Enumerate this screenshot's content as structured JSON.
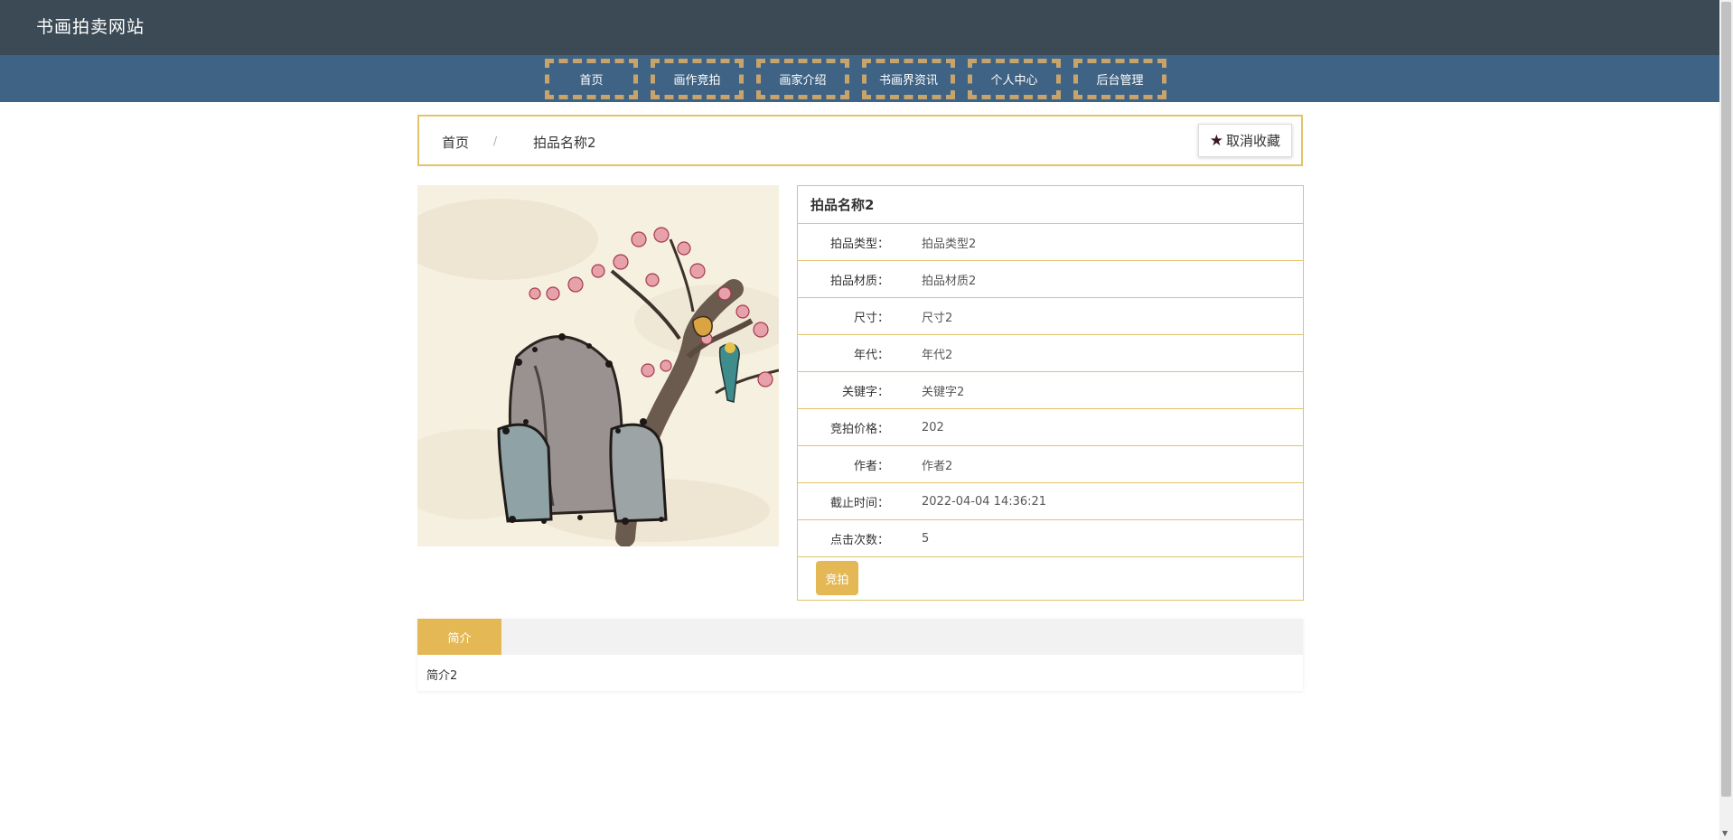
{
  "site": {
    "title": "书画拍卖网站"
  },
  "nav": {
    "items": [
      {
        "label": "首页"
      },
      {
        "label": "画作竞拍"
      },
      {
        "label": "画家介绍"
      },
      {
        "label": "书画界资讯"
      },
      {
        "label": "个人中心"
      },
      {
        "label": "后台管理"
      }
    ]
  },
  "breadcrumb": {
    "home": "首页",
    "separator": "/",
    "current": "拍品名称2"
  },
  "favorite_button": {
    "icon": "star-icon",
    "label": "取消收藏"
  },
  "detail": {
    "title": "拍品名称2",
    "rows": [
      {
        "label": "拍品类型：",
        "value": "拍品类型2"
      },
      {
        "label": "拍品材质：",
        "value": "拍品材质2"
      },
      {
        "label": "尺寸：",
        "value": "尺寸2"
      },
      {
        "label": "年代：",
        "value": "年代2"
      },
      {
        "label": "关键字：",
        "value": "关键字2"
      },
      {
        "label": "竞拍价格：",
        "value": "202"
      },
      {
        "label": "作者：",
        "value": "作者2"
      },
      {
        "label": "截止时间：",
        "value": "2022-04-04 14:36:21"
      },
      {
        "label": "点击次数：",
        "value": "5"
      }
    ],
    "bid_button": "竞拍"
  },
  "tabs": {
    "active": "简介",
    "content": "简介2"
  },
  "colors": {
    "topbar": "#3b4a55",
    "navbar": "#3f6384",
    "nav_border": "#c7a46c",
    "accent_gold": "#e4b955",
    "table_border": "#e2c36b"
  }
}
